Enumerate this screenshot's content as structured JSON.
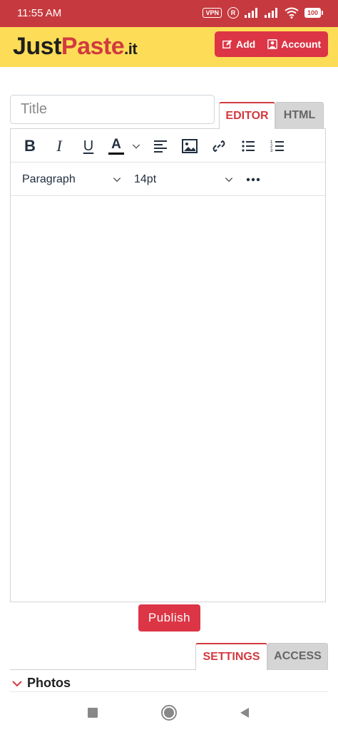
{
  "status_bar": {
    "time": "11:55 AM",
    "vpn": "VPN",
    "r_badge": "R",
    "battery": "100"
  },
  "header": {
    "logo_just": "Just",
    "logo_paste": "Paste",
    "logo_tld": ".it",
    "add_label": "Add",
    "account_label": "Account"
  },
  "form": {
    "title_placeholder": "Title",
    "tab_editor": "EDITOR",
    "tab_html": "HTML"
  },
  "toolbar": {
    "bold": "B",
    "italic": "I",
    "underline": "U",
    "text_color": "A",
    "block_format": "Paragraph",
    "font_size": "14pt"
  },
  "publish_label": "Publish",
  "bottom_tabs": {
    "settings": "SETTINGS",
    "access": "ACCESS"
  },
  "photos_label": "Photos",
  "colors": {
    "brand_red": "#dc3545",
    "header_yellow": "#fddd57",
    "status_bar": "#c63a3f"
  }
}
